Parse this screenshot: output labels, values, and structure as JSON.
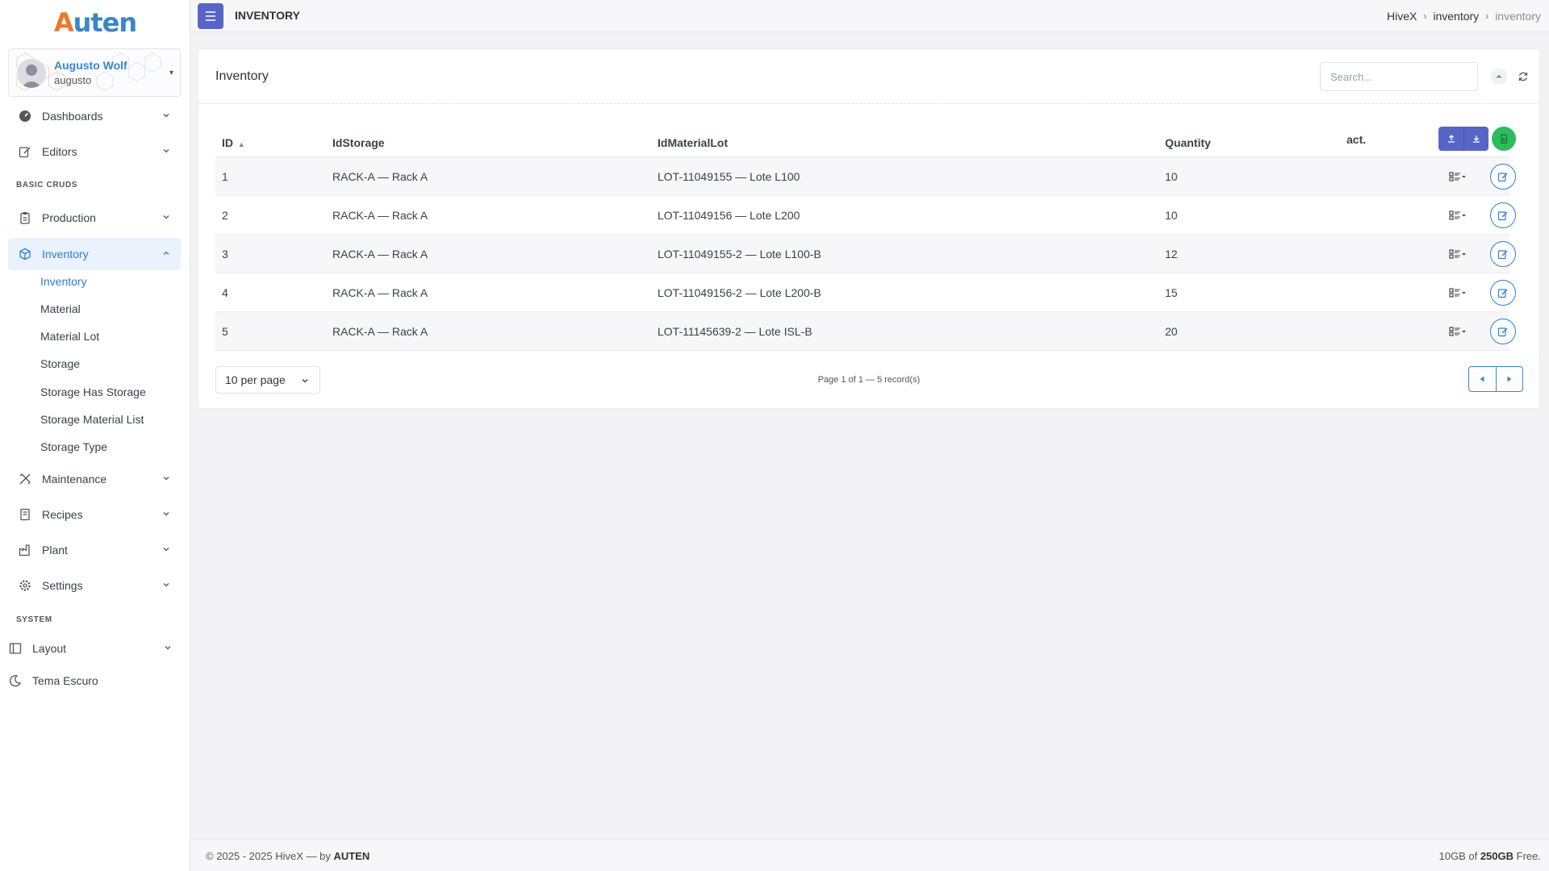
{
  "colors": {
    "accent": "#2f7fd1",
    "primary_btn": "#5766c6",
    "excel_btn": "#2dbb5d",
    "logo_orange": "#e77b2c"
  },
  "logo": {
    "text_a": "A",
    "text_rest": "uten"
  },
  "user": {
    "name": "Augusto Wolf",
    "login": "augusto"
  },
  "sidebar": {
    "items": [
      {
        "label": "Dashboards",
        "icon": "gauge-icon"
      },
      {
        "label": "Editors",
        "icon": "edit-icon"
      }
    ],
    "section_basic": "BASIC CRUDS",
    "crud_items": [
      {
        "label": "Production",
        "icon": "clipboard-icon"
      },
      {
        "label": "Inventory",
        "icon": "box-icon"
      }
    ],
    "inventory_sub": [
      "Inventory",
      "Material",
      "Material Lot",
      "Storage",
      "Storage Has Storage",
      "Storage Material List",
      "Storage Type"
    ],
    "more_items": [
      {
        "label": "Maintenance",
        "icon": "tools-icon"
      },
      {
        "label": "Recipes",
        "icon": "book-icon"
      },
      {
        "label": "Plant",
        "icon": "factory-icon"
      },
      {
        "label": "Settings",
        "icon": "gear-icon"
      }
    ],
    "section_system": "SYSTEM",
    "layout_label": "Layout",
    "theme_label": "Tema Escuro"
  },
  "topbar": {
    "title": "INVENTORY",
    "breadcrumb": [
      "HiveX",
      "inventory",
      "inventory"
    ]
  },
  "card": {
    "title": "Inventory",
    "search_placeholder": "Search..."
  },
  "table": {
    "headers": {
      "id": "ID",
      "sort_indicator": "▲",
      "storage": "IdStorage",
      "lot": "IdMaterialLot",
      "qty": "Quantity",
      "actions": "act."
    },
    "rows": [
      {
        "id": "1",
        "storage": "RACK-A — Rack A",
        "lot": "LOT-11049155 — Lote L100",
        "qty": "10"
      },
      {
        "id": "2",
        "storage": "RACK-A — Rack A",
        "lot": "LOT-11049156 — Lote L200",
        "qty": "10"
      },
      {
        "id": "3",
        "storage": "RACK-A — Rack A",
        "lot": "LOT-11049155-2 — Lote L100-B",
        "qty": "12"
      },
      {
        "id": "4",
        "storage": "RACK-A — Rack A",
        "lot": "LOT-11049156-2 — Lote L200-B",
        "qty": "15"
      },
      {
        "id": "5",
        "storage": "RACK-A — Rack A",
        "lot": "LOT-11145639-2 — Lote ISL-B",
        "qty": "20"
      }
    ]
  },
  "pagination": {
    "per_page": "10 per page",
    "info": "Page 1 of 1 — 5 record(s)"
  },
  "footer": {
    "copyright": "© 2025 - 2025 HiveX — by ",
    "brand": "AUTEN",
    "storage_used": "10GB",
    "storage_of": " of ",
    "storage_total": "250GB",
    "storage_free": " Free."
  }
}
